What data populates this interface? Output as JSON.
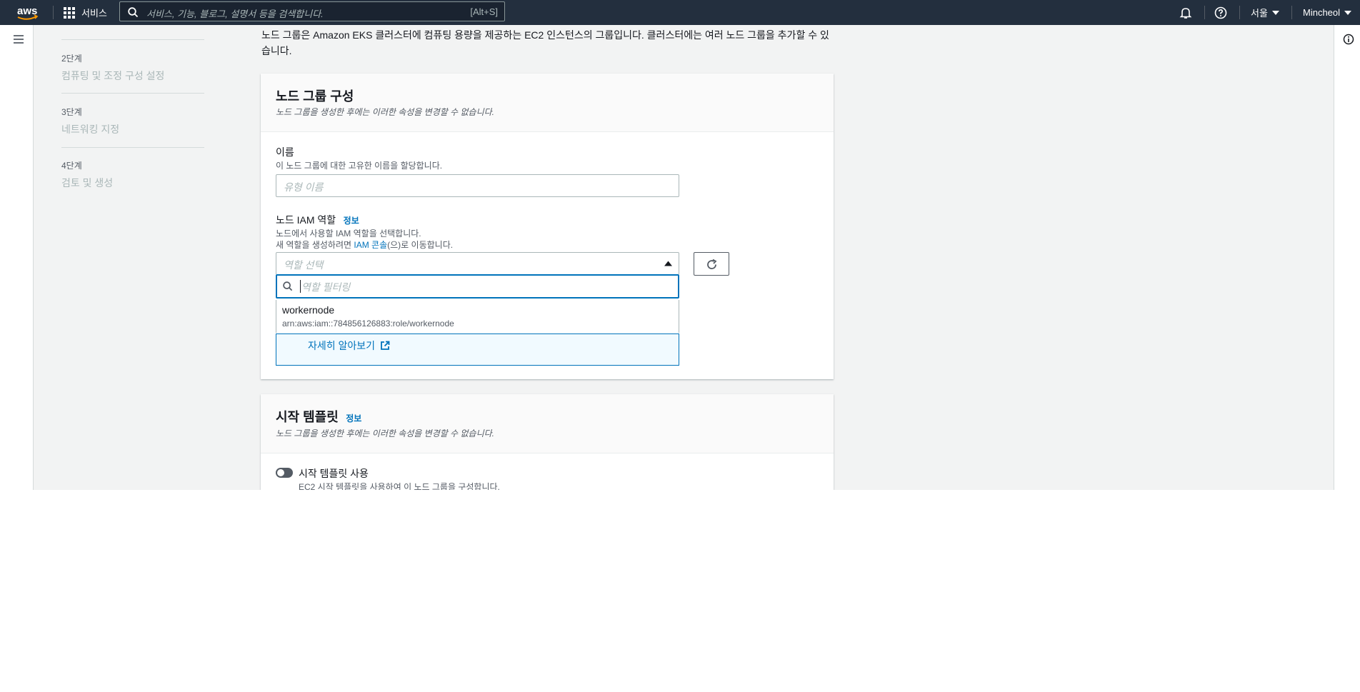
{
  "topbar": {
    "services_label": "서비스",
    "search_placeholder": "서비스, 기능, 블로그, 설명서 등을 검색합니다.",
    "search_shortcut": "[Alt+S]",
    "region_label": "서울",
    "user_label": "Mincheol",
    "logo_text": "aws"
  },
  "steps": [
    {
      "num": "2단계",
      "label": "컴퓨팅 및 조정 구성 설정"
    },
    {
      "num": "3단계",
      "label": "네트워킹 지정"
    },
    {
      "num": "4단계",
      "label": "검토 및 생성"
    }
  ],
  "intro": "노드 그룹은 Amazon EKS 클러스터에 컴퓨팅 용량을 제공하는 EC2 인스턴스의 그룹입니다. 클러스터에는 여러 노드 그룹을 추가할 수 있습니다.",
  "node_group_config": {
    "title": "노드 그룹 구성",
    "description": "노드 그룹을 생성한 후에는 이러한 속성을 변경할 수 없습니다.",
    "name_label": "이름",
    "name_description": "이 노드 그룹에 대한 고유한 이름을 할당합니다.",
    "name_placeholder": "유형 이름",
    "iam_label": "노드 IAM 역할",
    "iam_info": "정보",
    "iam_desc1": "노드에서 사용할 IAM 역할을 선택합니다.",
    "iam_desc2_prefix": "새 역할을 생성하려면 ",
    "iam_desc2_link": "IAM 콘솔",
    "iam_desc2_suffix": "(으)로 이동합니다.",
    "role_placeholder": "역할 선택",
    "filter_placeholder": "역할 필터링",
    "options": [
      {
        "name": "workernode",
        "arn": "arn:aws:iam::784856126883:role/workernode"
      }
    ],
    "learn_more": "자세히 알아보기"
  },
  "launch_template": {
    "title": "시작 템플릿",
    "info": "정보",
    "description": "노드 그룹을 생성한 후에는 이러한 속성을 변경할 수 없습니다.",
    "toggle_label": "시작 템플릿 사용",
    "toggle_desc": "EC2 시작 템플릿을 사용하여 이 노드 그룹을 구성합니다.",
    "toggle_on": false
  },
  "colors": {
    "header_bg": "#232f3e",
    "link": "#0073bb",
    "focus": "#0073bb"
  },
  "icons": [
    "aws-logo-icon",
    "grid-icon",
    "search-icon",
    "bell-icon",
    "help-icon",
    "caret-down-icon",
    "menu-icon",
    "info-icon",
    "caret-up-icon",
    "refresh-icon",
    "external-link-icon",
    "toggle-icon"
  ]
}
